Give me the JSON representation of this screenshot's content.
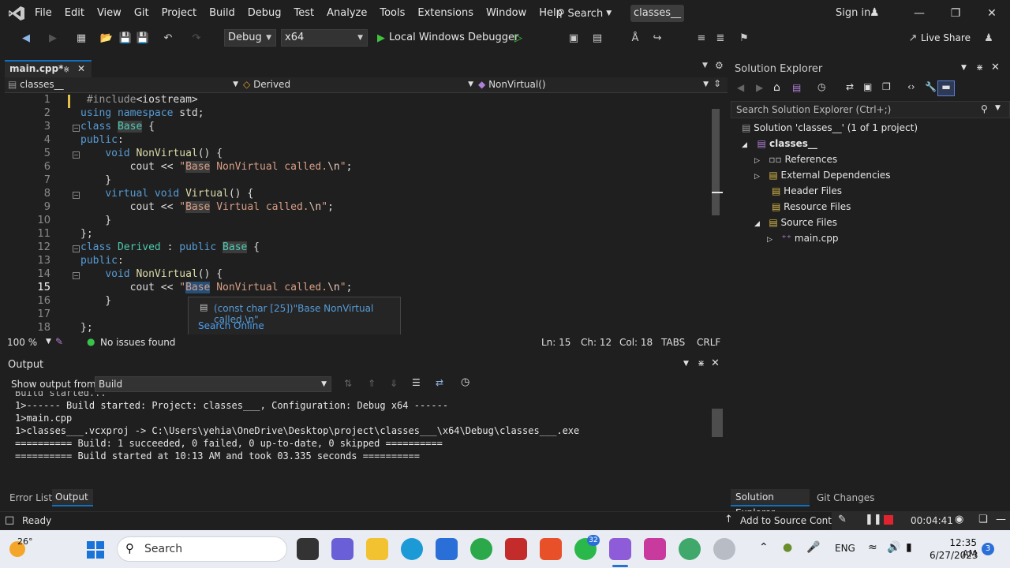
{
  "menu": [
    "File",
    "Edit",
    "View",
    "Git",
    "Project",
    "Build",
    "Debug",
    "Test",
    "Analyze",
    "Tools",
    "Extensions",
    "Window",
    "Help"
  ],
  "search_label": "Search",
  "solution_name": "classes__",
  "signin": "Sign in",
  "toolbar": {
    "config": "Debug",
    "platform": "x64",
    "debugger": "Local Windows Debugger",
    "liveshare": "Live Share"
  },
  "editor": {
    "tab_label": "main.cpp*",
    "nav_project": "classes__",
    "nav_class": "Derived",
    "nav_member": "NonVirtual()",
    "line_numbers": [
      "1",
      "2",
      "3",
      "4",
      "5",
      "6",
      "7",
      "8",
      "9",
      "10",
      "11",
      "12",
      "13",
      "14",
      "15",
      "16",
      "17",
      "18"
    ],
    "zoom": "100 %",
    "issues": "No issues found",
    "ln": "Ln: 15",
    "ch": "Ch: 12",
    "col": "Col: 18",
    "tabs": "TABS",
    "crlf": "CRLF"
  },
  "tooltip": {
    "text": "(const char [25])\"Base NonVirtual called.\\n\"",
    "search": "Search Online"
  },
  "output": {
    "title": "Output",
    "show_from_label": "Show output from:",
    "source": "Build",
    "lines": [
      "Build started...",
      "1>------ Build started: Project: classes___, Configuration: Debug x64 ------",
      "1>main.cpp",
      "1>classes___.vcxproj -> C:\\Users\\yehia\\OneDrive\\Desktop\\project\\classes___\\x64\\Debug\\classes___.exe",
      "========== Build: 1 succeeded, 0 failed, 0 up-to-date, 0 skipped ==========",
      "========== Build started at 10:13 AM and took 03.335 seconds =========="
    ],
    "tab_errors": "Error List",
    "tab_output": "Output"
  },
  "solution_explorer": {
    "title": "Solution Explorer",
    "search_placeholder": "Search Solution Explorer (Ctrl+;)",
    "solution": "Solution 'classes__' (1 of 1 project)",
    "project": "classes__",
    "items": [
      "References",
      "External Dependencies",
      "Header Files",
      "Resource Files",
      "Source Files"
    ],
    "file": "main.cpp",
    "tab_se": "Solution Explorer",
    "tab_git": "Git Changes"
  },
  "status": {
    "ready": "Ready",
    "source_control": "Add to Source Control",
    "timer": "00:04:41",
    "notif": "3"
  },
  "taskbar": {
    "weather": "26°",
    "search": "Search",
    "lang": "ENG",
    "time": "12:35 AM",
    "date": "6/27/2023",
    "badge_whatsapp": "32"
  }
}
